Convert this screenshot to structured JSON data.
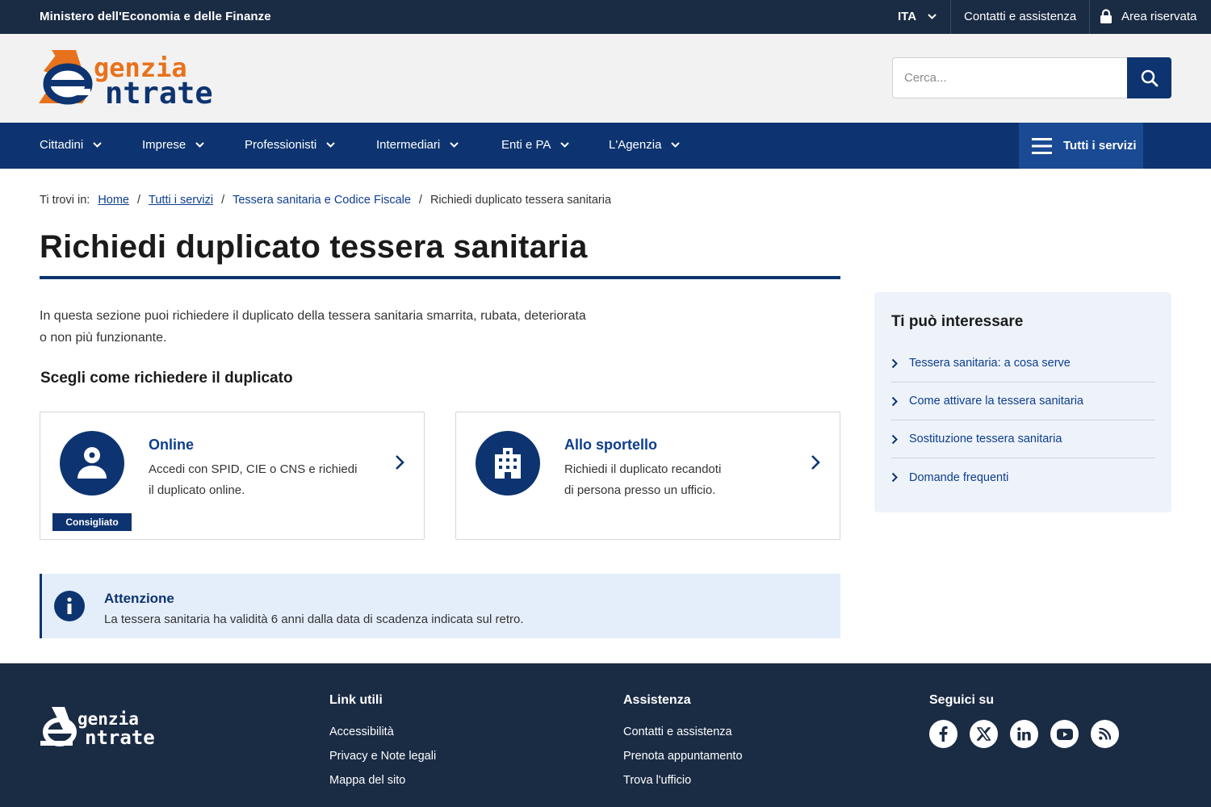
{
  "topbar": {
    "ministry": "Ministero dell'Economia e delle Finanze",
    "language": "ITA",
    "contact": "Contatti e assistenza",
    "reserved_area": "Area riservata"
  },
  "header": {
    "logo_text_line1": "genzia",
    "logo_text_line2": "ntrate",
    "search_placeholder": "Cerca..."
  },
  "nav": {
    "items": [
      {
        "label": "Cittadini"
      },
      {
        "label": "Imprese"
      },
      {
        "label": "Professionisti"
      },
      {
        "label": "Intermediari"
      },
      {
        "label": "Enti e PA"
      },
      {
        "label": "L'Agenzia"
      }
    ],
    "all_services": "Tutti i servizi"
  },
  "breadcrumb": {
    "prefix": "Ti trovi in:",
    "items": [
      "Home",
      "Tutti i servizi",
      "Tessera sanitaria e Codice Fiscale",
      "Richiedi duplicato tessera sanitaria"
    ]
  },
  "main": {
    "title": "Richiedi duplicato tessera sanitaria",
    "intro_line1": "In questa sezione puoi richiedere il duplicato della tessera sanitaria smarrita, rubata, deteriorata",
    "intro_line2": "o non più funzionante.",
    "subtitle": "Scegli come richiedere il duplicato",
    "cards": [
      {
        "title": "Online",
        "desc_line1": "Accedi con SPID, CIE o CNS e richiedi",
        "desc_line2": "il duplicato online.",
        "badge": "Consigliato",
        "icon": "user-icon"
      },
      {
        "title": "Allo sportello",
        "desc_line1": "Richiedi il duplicato recandoti",
        "desc_line2": "di persona presso un ufficio.",
        "icon": "building-icon"
      }
    ],
    "alert": {
      "title": "Attenzione",
      "text": "La tessera sanitaria ha validità 6 anni dalla data di scadenza indicata sul retro."
    }
  },
  "aside": {
    "title": "Ti può interessare",
    "links": [
      "Tessera sanitaria: a cosa serve",
      "Come attivare la tessera sanitaria",
      "Sostituzione tessera sanitaria",
      "Domande frequenti"
    ]
  },
  "footer": {
    "logo_text_line1": "genzia",
    "logo_text_line2": "ntrate",
    "useful_links": {
      "title": "Link utili",
      "items": [
        "Accessibilità",
        "Privacy e Note legali",
        "Mappa del sito"
      ]
    },
    "assistance": {
      "title": "Assistenza",
      "items": [
        "Contatti e assistenza",
        "Prenota appuntamento",
        "Trova l'ufficio"
      ]
    },
    "social": {
      "title": "Seguici su",
      "icons": [
        "facebook-icon",
        "x-icon",
        "linkedin-icon",
        "youtube-icon",
        "rss-icon"
      ]
    }
  },
  "colors": {
    "brand_navy": "#0d3470",
    "dark_bar": "#1a2b44",
    "logo_orange": "#e8721c",
    "link_blue": "#0d3d8f",
    "alert_bg": "#e4eefa"
  }
}
